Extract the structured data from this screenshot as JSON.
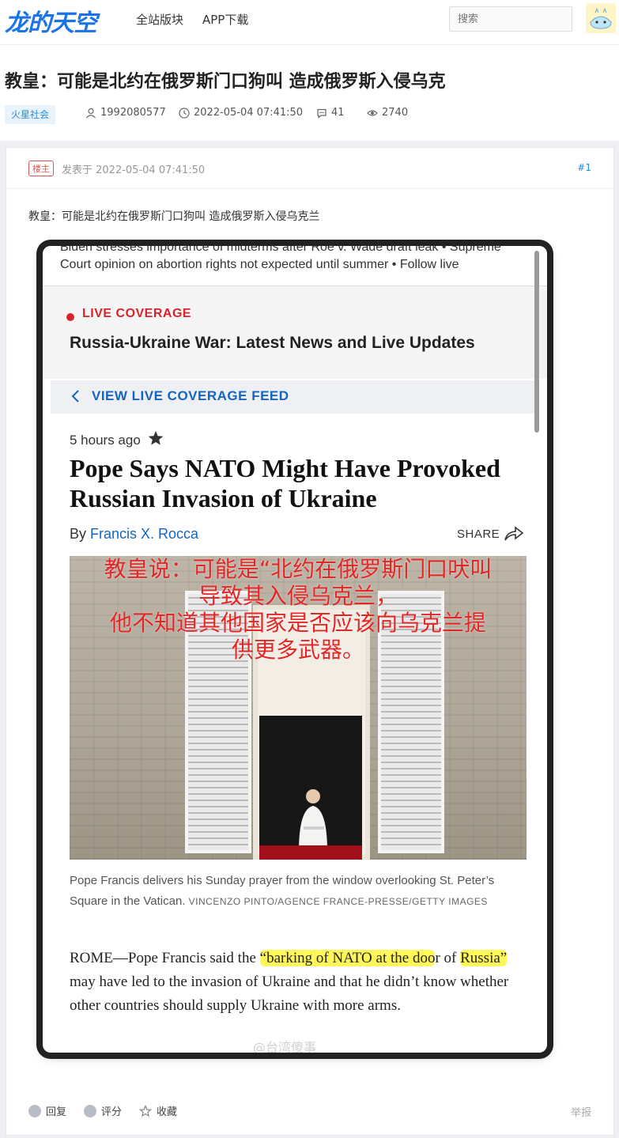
{
  "site": {
    "logo": "龙的天空",
    "nav": [
      "全站版块",
      "APP下载"
    ],
    "search_placeholder": "搜索"
  },
  "thread": {
    "title": "教皇：可能是北约在俄罗斯门口狗叫 造成俄罗斯入侵乌克",
    "tag": "火星社会",
    "author": "1992080577",
    "datetime": "2022-05-04 07:41:50",
    "replies": "41",
    "views": "2740"
  },
  "post": {
    "owner_badge": "楼主",
    "posted_label": "发表于 2022-05-04 07:41:50",
    "floor": "#1",
    "text": "教皇：可能是北约在俄罗斯门口狗叫 造成俄罗斯入侵乌克兰"
  },
  "screenshot": {
    "top_line1": "Biden stresses importance of midterms after Roe v. Wade draft leak • Supreme",
    "top_line2": "Court opinion on abortion rights not expected until summer • Follow live",
    "live_label": "LIVE COVERAGE",
    "live_headline": "Russia-Ukraine War: Latest News and Live Updates",
    "feed_label": "VIEW LIVE COVERAGE FEED",
    "time": "5 hours ago",
    "headline": "Pope Says NATO Might Have Provoked Russian Invasion of Ukraine",
    "by": "By ",
    "author": "Francis X. Rocca",
    "share": "SHARE",
    "overlay_lines": [
      "教皇说：可能是“北约在俄罗斯门口吠叫",
      "导致其入侵乌克兰，",
      "他不知道其他国家是否应该向乌克兰提",
      "供更多武器。"
    ],
    "caption": "Pope Francis delivers his Sunday prayer from the window overlooking St. Peter’s Square in the Vatican.",
    "credit": "VINCENZO PINTO/AGENCE FRANCE-PRESSE/GETTY IMAGES",
    "body_pre": "ROME—Pope Francis said the ",
    "body_quote1": "“barking of NATO at the doo",
    "body_mid1": "r of ",
    "body_quote2": "Russia”",
    "body_post": " may have led to the invasion of Ukraine and that he didn’t know whether other countries should supply Ukraine with more arms.",
    "watermark": "@台湾傻事"
  },
  "actions": {
    "reply": "回复",
    "rate": "评分",
    "favorite": "收藏",
    "report": "举报"
  }
}
